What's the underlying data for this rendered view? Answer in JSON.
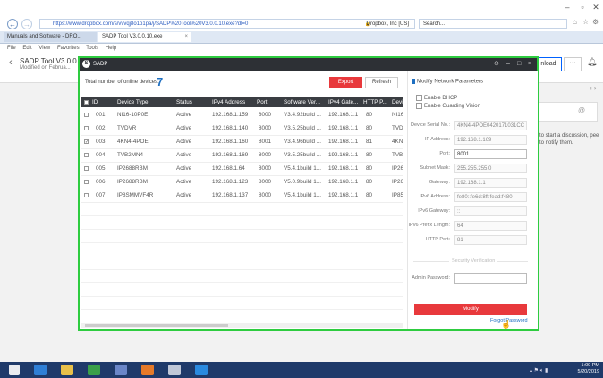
{
  "browser": {
    "url": "https://www.dropbox.com/s/vvvqj8o1o1pa/j/SADP%20Tool%20V3.0.0.10.exe?dl=0",
    "lock_label": "Dropbox, Inc [US]",
    "search_placeholder": "Search...",
    "tabs": [
      {
        "label": "Manuals and Software - DRO..."
      },
      {
        "label": "SADP Tool V3.0.0.10.exe"
      }
    ],
    "menu": [
      "File",
      "Edit",
      "View",
      "Favorites",
      "Tools",
      "Help"
    ]
  },
  "dropbox": {
    "title": "SADP Tool V3.0.0...",
    "subtitle": "Modified on Februa...",
    "download_label": "nload",
    "more_label": "···",
    "side_text": "to start a discussion, pee to notify them."
  },
  "sadp": {
    "title": "SADP",
    "total_label": "Total number of online devices:",
    "total_count": "7",
    "export_label": "Export",
    "refresh_label": "Refresh",
    "columns": [
      "ID",
      "Device Type",
      "Status",
      "IPv4 Address",
      "Port",
      "Software Ver...",
      "IPv4 Gate...",
      "HTTP P...",
      "Devi"
    ],
    "rows": [
      {
        "id": "001",
        "type": "NI16-10P0E",
        "status": "Active",
        "ip": "192.168.1.159",
        "port": "8000",
        "ver": "V3.4.92build ...",
        "gw": "192.168.1.1",
        "http": "80",
        "dev": "NI16",
        "checked": false
      },
      {
        "id": "002",
        "type": "TVDVR",
        "status": "Active",
        "ip": "192.168.1.140",
        "port": "8000",
        "ver": "V3.5.25build ...",
        "gw": "192.168.1.1",
        "http": "80",
        "dev": "TVDO",
        "checked": false
      },
      {
        "id": "003",
        "type": "4KN4-4POE",
        "status": "Active",
        "ip": "192.168.1.160",
        "port": "8001",
        "ver": "V3.4.96build ...",
        "gw": "192.168.1.1",
        "http": "81",
        "dev": "4KN",
        "checked": true
      },
      {
        "id": "004",
        "type": "TVB2MN4",
        "status": "Active",
        "ip": "192.168.1.169",
        "port": "8000",
        "ver": "V3.5.25build ...",
        "gw": "192.168.1.1",
        "http": "80",
        "dev": "TVB",
        "checked": false
      },
      {
        "id": "005",
        "type": "IP2688RBM",
        "status": "Active",
        "ip": "192.168.1.64",
        "port": "8000",
        "ver": "V5.4.1build 1...",
        "gw": "192.168.1.1",
        "http": "80",
        "dev": "IP26",
        "checked": false
      },
      {
        "id": "006",
        "type": "IP2688RBM",
        "status": "Active",
        "ip": "192.168.1.123",
        "port": "8000",
        "ver": "V5.0.9build 1...",
        "gw": "192.168.1.1",
        "http": "80",
        "dev": "IP26",
        "checked": false
      },
      {
        "id": "007",
        "type": "IP8SMMVF4R",
        "status": "Active",
        "ip": "192.168.1.137",
        "port": "8000",
        "ver": "V5.4.1build 1...",
        "gw": "192.168.1.1",
        "http": "80",
        "dev": "IP85",
        "checked": false
      }
    ],
    "panel": {
      "title": "Modify Network Parameters",
      "enable_dhcp": "Enable DHCP",
      "enable_guarding": "Enable Guarding Vision",
      "fields": [
        {
          "label": "Device Serial No.:",
          "value": "4KN4-4POE0420171031CC",
          "edit": false
        },
        {
          "label": "IP Address:",
          "value": "192.168.1.169",
          "edit": false
        },
        {
          "label": "Port:",
          "value": "8001",
          "edit": true
        },
        {
          "label": "Subnet Mask:",
          "value": "255.255.255.0",
          "edit": false
        },
        {
          "label": "Gateway:",
          "value": "192.168.1.1",
          "edit": false
        },
        {
          "label": "IPv6 Address:",
          "value": "fe80::fe6d:8ff:fead:f480",
          "edit": false
        },
        {
          "label": "IPv6 Gateway:",
          "value": "::",
          "edit": false
        },
        {
          "label": "IPv6 Prefix Length:",
          "value": "64",
          "edit": false
        },
        {
          "label": "HTTP Port:",
          "value": "81",
          "edit": false
        }
      ],
      "security_label": "Security Verification",
      "admin_password_label": "Admin Password:",
      "modify_label": "Modify",
      "forgot_label": "Forgot Password"
    }
  },
  "taskbar": {
    "time": "1:00 PM",
    "date": "5/20/2019"
  }
}
